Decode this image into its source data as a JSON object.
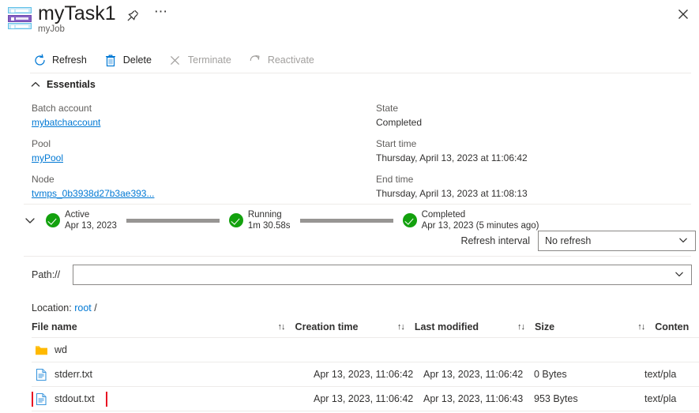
{
  "header": {
    "title": "myTask1",
    "subtitle": "myJob",
    "icon": "batch-task-icon",
    "pin_icon": "pin-icon",
    "more_icon": "ellipsis-icon",
    "close_icon": "close-icon"
  },
  "toolbar": {
    "items": [
      {
        "label": "Refresh",
        "icon": "refresh-icon",
        "disabled": false
      },
      {
        "label": "Delete",
        "icon": "trash-icon",
        "disabled": false
      },
      {
        "label": "Terminate",
        "icon": "x-icon",
        "disabled": true
      },
      {
        "label": "Reactivate",
        "icon": "restore-icon",
        "disabled": true
      }
    ]
  },
  "essentials": {
    "section_label": "Essentials",
    "chevron_icon": "chevron-up-icon",
    "left_fields": [
      {
        "key": "Batch account",
        "value": "mybatchaccount",
        "is_link": true
      },
      {
        "key": "Pool",
        "value": "myPool",
        "is_link": true
      },
      {
        "key": "Node",
        "value": "tvmps_0b3938d27b3ae393...",
        "is_link": true
      }
    ],
    "right_fields": [
      {
        "key": "State",
        "value": "Completed",
        "is_link": false
      },
      {
        "key": "Start time",
        "value": "Thursday, April 13, 2023 at 11:06:42",
        "is_link": false
      },
      {
        "key": "End time",
        "value": "Thursday, April 13, 2023 at 11:08:13",
        "is_link": false
      }
    ]
  },
  "timeline": {
    "chevron_icon": "chevron-down-icon",
    "steps": [
      {
        "label": "Active",
        "detail": "Apr 13, 2023",
        "status_icon": "check-circle-icon"
      },
      {
        "label": "Running",
        "detail": "1m 30.58s",
        "status_icon": "check-circle-icon"
      },
      {
        "label": "Completed",
        "detail": "Apr 13, 2023 (5 minutes ago)",
        "status_icon": "check-circle-icon"
      }
    ]
  },
  "refresh": {
    "label": "Refresh interval",
    "selected": "No refresh",
    "chevron_icon": "chevron-down-icon"
  },
  "path": {
    "label": "Path://",
    "value": "",
    "placeholder": "",
    "chevron_icon": "chevron-down-icon"
  },
  "location": {
    "prefix": "Location:",
    "link": "root",
    "suffix": "/"
  },
  "file_table": {
    "sort_icon": "sort-updown-icon",
    "columns": [
      {
        "label": "File name",
        "sortable": false
      },
      {
        "label": "Creation time",
        "sortable": true
      },
      {
        "label": "Last modified",
        "sortable": true
      },
      {
        "label": "Size",
        "sortable": true
      },
      {
        "label": "Conten",
        "sortable": true
      }
    ],
    "rows": [
      {
        "name": "wd",
        "icon": "folder-icon",
        "creation_time": "",
        "last_modified": "",
        "size": "",
        "content_type": "",
        "highlighted": false
      },
      {
        "name": "stderr.txt",
        "icon": "file-icon",
        "creation_time": "Apr 13, 2023, 11:06:42",
        "last_modified": "Apr 13, 2023, 11:06:42",
        "size": "0 Bytes",
        "content_type": "text/pla",
        "highlighted": false
      },
      {
        "name": "stdout.txt",
        "icon": "file-icon",
        "creation_time": "Apr 13, 2023, 11:06:42",
        "last_modified": "Apr 13, 2023, 11:06:43",
        "size": "953 Bytes",
        "content_type": "text/pla",
        "highlighted": true
      }
    ]
  },
  "colors": {
    "accent": "#0078d4",
    "success": "#13a10e",
    "highlight": "#e81123",
    "folder": "#ffb900"
  }
}
